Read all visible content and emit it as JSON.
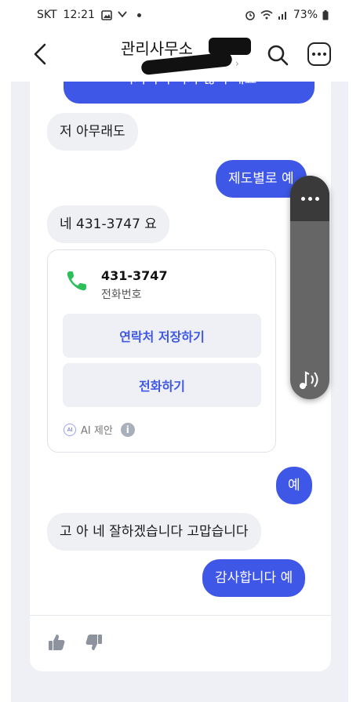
{
  "status_bar": {
    "carrier": "SKT",
    "time": "12:21",
    "battery": "73%"
  },
  "header": {
    "title": "관리사무소"
  },
  "messages": [
    {
      "side": "out",
      "text": "여기서 우리가 많이 해요"
    },
    {
      "side": "in",
      "text": "저 아무래도"
    },
    {
      "side": "out",
      "text": "제도별로 예"
    },
    {
      "side": "in",
      "text": "네 431-3747 요"
    },
    {
      "side": "out",
      "text": "예"
    },
    {
      "side": "in",
      "text": "고 아 네 잘하겠습니다 고맙습니다"
    },
    {
      "side": "out",
      "text": "감사합니다 예"
    }
  ],
  "contact_card": {
    "number": "431-3747",
    "label": "전화번호",
    "save_button": "연락처 저장하기",
    "call_button": "전화하기",
    "ai_badge": "AI",
    "ai_label": "AI 제안",
    "info_glyph": "i"
  },
  "colors": {
    "accent": "#3f57e6",
    "incoming_bubble": "#eef0f4",
    "phone_icon": "#2fbf5a"
  },
  "icons": [
    "back-icon",
    "search-icon",
    "more-icon",
    "phone-icon",
    "info-icon",
    "thumbs-up-icon",
    "thumbs-down-icon",
    "sound-icon"
  ]
}
